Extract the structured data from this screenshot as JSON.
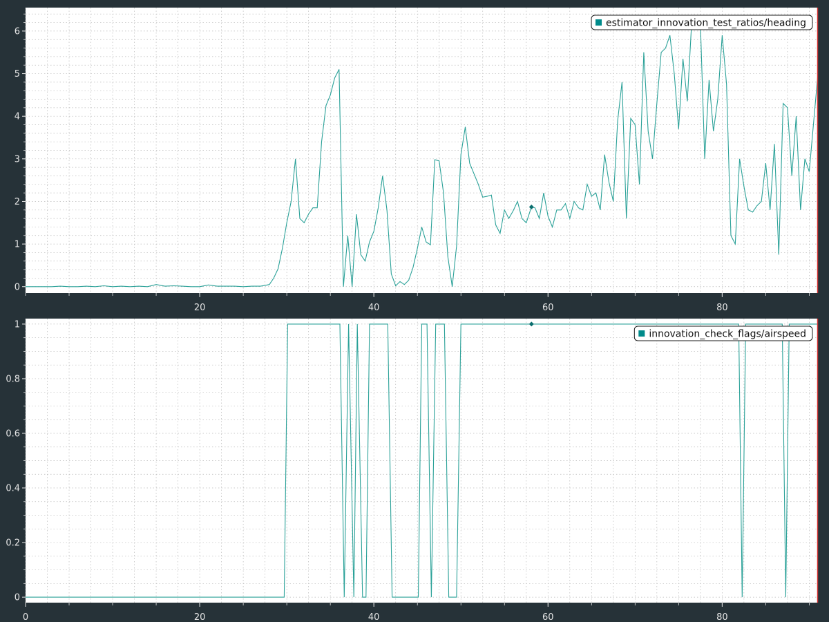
{
  "theme": {
    "background": "#263238",
    "plot_background": "#ffffff",
    "line_color": "#2aa198",
    "legend_swatch": "#008b8b",
    "grid_color": "#b8b8b8",
    "tick_text_color": "#e6e6e6",
    "cursor_color": "#d03030"
  },
  "chart_data": [
    {
      "type": "line",
      "grid": true,
      "legend_position": "top-right",
      "xlim": [
        0,
        91
      ],
      "ylim": [
        -0.15,
        6.55
      ],
      "x_ticks": [
        {
          "value": 20,
          "label": "20"
        },
        {
          "value": 40,
          "label": "40"
        },
        {
          "value": 60,
          "label": "60"
        },
        {
          "value": 80,
          "label": "80"
        }
      ],
      "y_ticks": [
        {
          "value": 0,
          "label": "0"
        },
        {
          "value": 1,
          "label": "1"
        },
        {
          "value": 2,
          "label": "2"
        },
        {
          "value": 3,
          "label": "3"
        },
        {
          "value": 4,
          "label": "4"
        },
        {
          "value": 5,
          "label": "5"
        },
        {
          "value": 6,
          "label": "6"
        }
      ],
      "marker": {
        "x": 58.1,
        "y": 1.87
      },
      "series": [
        {
          "name": "estimator_innovation_test_ratios/heading",
          "points": [
            [
              0,
              0
            ],
            [
              2,
              0
            ],
            [
              3,
              0
            ],
            [
              4,
              0.01
            ],
            [
              5,
              0
            ],
            [
              6,
              0
            ],
            [
              7,
              0.01
            ],
            [
              8,
              0
            ],
            [
              9,
              0.02
            ],
            [
              10,
              0
            ],
            [
              11,
              0.01
            ],
            [
              12,
              0
            ],
            [
              13,
              0.01
            ],
            [
              14,
              0
            ],
            [
              15,
              0.05
            ],
            [
              16,
              0.01
            ],
            [
              17,
              0.02
            ],
            [
              18,
              0.01
            ],
            [
              19,
              0
            ],
            [
              20,
              0
            ],
            [
              21,
              0.04
            ],
            [
              22,
              0.01
            ],
            [
              23,
              0.01
            ],
            [
              24,
              0.01
            ],
            [
              25,
              0
            ],
            [
              26,
              0.01
            ],
            [
              27,
              0.01
            ],
            [
              28,
              0.05
            ],
            [
              28.5,
              0.2
            ],
            [
              29,
              0.42
            ],
            [
              29.5,
              0.9
            ],
            [
              30,
              1.5
            ],
            [
              30.5,
              2.0
            ],
            [
              31,
              3.0
            ],
            [
              31.5,
              1.6
            ],
            [
              32,
              1.5
            ],
            [
              32.5,
              1.7
            ],
            [
              33,
              1.85
            ],
            [
              33.5,
              1.85
            ],
            [
              34,
              3.4
            ],
            [
              34.5,
              4.25
            ],
            [
              35,
              4.5
            ],
            [
              35.5,
              4.9
            ],
            [
              36,
              5.1
            ],
            [
              36.5,
              0
            ],
            [
              37,
              1.2
            ],
            [
              37.5,
              0
            ],
            [
              38,
              1.7
            ],
            [
              38.5,
              0.75
            ],
            [
              39,
              0.6
            ],
            [
              39.5,
              1.05
            ],
            [
              40,
              1.3
            ],
            [
              40.5,
              1.85
            ],
            [
              41,
              2.6
            ],
            [
              41.5,
              1.8
            ],
            [
              42,
              0.3
            ],
            [
              42.5,
              0.02
            ],
            [
              43,
              0.12
            ],
            [
              43.5,
              0.05
            ],
            [
              44,
              0.15
            ],
            [
              44.5,
              0.45
            ],
            [
              45,
              0.9
            ],
            [
              45.5,
              1.4
            ],
            [
              46,
              1.05
            ],
            [
              46.5,
              0.98
            ],
            [
              47,
              2.98
            ],
            [
              47.5,
              2.95
            ],
            [
              48,
              2.2
            ],
            [
              48.5,
              0.7
            ],
            [
              49,
              0
            ],
            [
              49.5,
              0.95
            ],
            [
              50,
              3.1
            ],
            [
              50.5,
              3.75
            ],
            [
              51,
              2.9
            ],
            [
              51.5,
              2.65
            ],
            [
              52,
              2.4
            ],
            [
              52.5,
              2.1
            ],
            [
              53,
              2.12
            ],
            [
              53.5,
              2.15
            ],
            [
              54,
              1.45
            ],
            [
              54.5,
              1.25
            ],
            [
              55,
              1.8
            ],
            [
              55.5,
              1.6
            ],
            [
              56,
              1.78
            ],
            [
              56.5,
              2.0
            ],
            [
              57,
              1.6
            ],
            [
              57.5,
              1.5
            ],
            [
              58.1,
              1.87
            ],
            [
              58.5,
              1.85
            ],
            [
              59,
              1.6
            ],
            [
              59.5,
              2.2
            ],
            [
              60,
              1.65
            ],
            [
              60.5,
              1.4
            ],
            [
              61,
              1.8
            ],
            [
              61.5,
              1.8
            ],
            [
              62,
              1.95
            ],
            [
              62.5,
              1.6
            ],
            [
              63,
              2.0
            ],
            [
              63.5,
              1.85
            ],
            [
              64,
              1.8
            ],
            [
              64.5,
              2.4
            ],
            [
              65,
              2.12
            ],
            [
              65.5,
              2.2
            ],
            [
              66,
              1.8
            ],
            [
              66.5,
              3.1
            ],
            [
              67,
              2.45
            ],
            [
              67.5,
              2.0
            ],
            [
              68,
              3.9
            ],
            [
              68.5,
              4.8
            ],
            [
              69,
              1.6
            ],
            [
              69.5,
              3.95
            ],
            [
              70,
              3.8
            ],
            [
              70.5,
              2.4
            ],
            [
              71,
              5.5
            ],
            [
              71.5,
              3.65
            ],
            [
              72,
              3.0
            ],
            [
              72.5,
              4.3
            ],
            [
              73,
              5.5
            ],
            [
              73.5,
              5.6
            ],
            [
              74,
              5.9
            ],
            [
              74.5,
              5.0
            ],
            [
              75,
              3.7
            ],
            [
              75.5,
              5.35
            ],
            [
              76,
              4.35
            ],
            [
              76.5,
              6.2
            ],
            [
              77,
              6.1
            ],
            [
              77.5,
              6.2
            ],
            [
              78,
              3.0
            ],
            [
              78.5,
              4.85
            ],
            [
              79,
              3.65
            ],
            [
              79.5,
              4.4
            ],
            [
              80,
              5.9
            ],
            [
              80.5,
              4.75
            ],
            [
              81,
              1.2
            ],
            [
              81.5,
              1.0
            ],
            [
              82,
              3.0
            ],
            [
              82.5,
              2.35
            ],
            [
              83,
              1.8
            ],
            [
              83.5,
              1.75
            ],
            [
              84,
              1.9
            ],
            [
              84.5,
              2.0
            ],
            [
              85,
              2.9
            ],
            [
              85.5,
              1.8
            ],
            [
              86,
              3.35
            ],
            [
              86.5,
              0.75
            ],
            [
              87,
              4.3
            ],
            [
              87.5,
              4.2
            ],
            [
              88,
              2.6
            ],
            [
              88.5,
              4.0
            ],
            [
              89,
              1.8
            ],
            [
              89.5,
              3.0
            ],
            [
              90,
              2.7
            ],
            [
              91,
              5.0
            ]
          ]
        }
      ]
    },
    {
      "type": "line",
      "grid": true,
      "legend_position": "top-right",
      "xlim": [
        0,
        91
      ],
      "ylim": [
        -0.02,
        1.02
      ],
      "x_ticks": [
        {
          "value": 0,
          "label": "0"
        },
        {
          "value": 20,
          "label": "20"
        },
        {
          "value": 40,
          "label": "40"
        },
        {
          "value": 60,
          "label": "60"
        },
        {
          "value": 80,
          "label": "80"
        }
      ],
      "y_ticks": [
        {
          "value": 0,
          "label": "0"
        },
        {
          "value": 0.2,
          "label": "0.2"
        },
        {
          "value": 0.4,
          "label": "0.4"
        },
        {
          "value": 0.6,
          "label": "0.6"
        },
        {
          "value": 0.8,
          "label": "0.8"
        },
        {
          "value": 1,
          "label": "1"
        }
      ],
      "marker": {
        "x": 58.1,
        "y": 1
      },
      "series": [
        {
          "name": "innovation_check_flags/airspeed",
          "points": [
            [
              0,
              0
            ],
            [
              29.7,
              0
            ],
            [
              30.1,
              1
            ],
            [
              36.1,
              1
            ],
            [
              36.6,
              0
            ],
            [
              37.1,
              1
            ],
            [
              37.7,
              0
            ],
            [
              38.1,
              1
            ],
            [
              38.7,
              0
            ],
            [
              39.1,
              0
            ],
            [
              39.5,
              1
            ],
            [
              41.6,
              1
            ],
            [
              42.1,
              0
            ],
            [
              45.1,
              0
            ],
            [
              45.5,
              1
            ],
            [
              46.1,
              1
            ],
            [
              46.6,
              0
            ],
            [
              47.1,
              1
            ],
            [
              48.1,
              1
            ],
            [
              48.6,
              0
            ],
            [
              49.5,
              0
            ],
            [
              50.0,
              1
            ],
            [
              81.9,
              1
            ],
            [
              82.3,
              0
            ],
            [
              82.7,
              1
            ],
            [
              86.9,
              1
            ],
            [
              87.3,
              0
            ],
            [
              87.7,
              1
            ],
            [
              91,
              1
            ]
          ]
        }
      ]
    }
  ]
}
